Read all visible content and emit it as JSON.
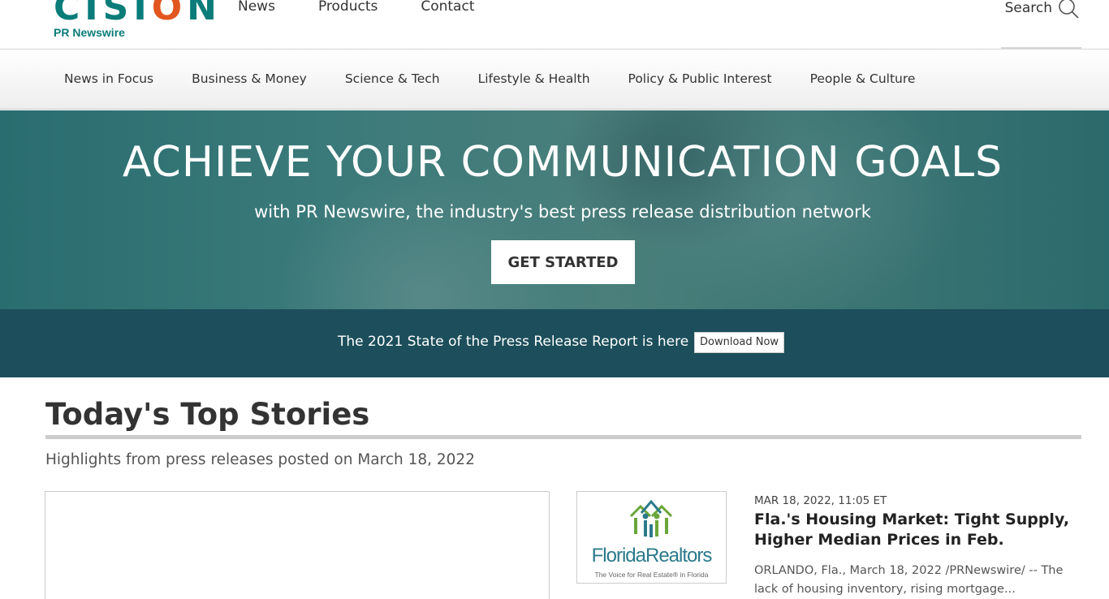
{
  "header": {
    "logo_word": "CISION",
    "logo_sub": "PR Newswire",
    "nav": [
      "News",
      "Products",
      "Contact"
    ],
    "search_label": "Search"
  },
  "categories": [
    "News in Focus",
    "Business & Money",
    "Science & Tech",
    "Lifestyle & Health",
    "Policy & Public Interest",
    "People & Culture"
  ],
  "hero": {
    "title": "ACHIEVE YOUR COMMUNICATION GOALS",
    "subtitle": "with PR Newswire, the industry's best press release distribution network",
    "cta_label": "GET STARTED"
  },
  "banner": {
    "text": "The 2021 State of the Press Release Report is here",
    "button_label": "Download Now"
  },
  "top_stories": {
    "title": "Today's Top Stories",
    "subtitle": "Highlights from press releases posted on March 18, 2022",
    "items": [
      {
        "logo_name": "FloridaRealtors",
        "logo_tagline": "The Voice for Real Estate® in Florida",
        "date": "MAR 18, 2022, 11:05 ET",
        "title": "Fla.'s Housing Market: Tight Supply, Higher Median Prices in Feb.",
        "summary": "ORLANDO, Fla., March 18, 2022 /PRNewswire/ -- The lack of housing inventory, rising mortgage..."
      }
    ]
  },
  "colors": {
    "brand_teal": "#0a7c7a",
    "brand_orange": "#e2561f",
    "banner_bg": "#1c4f5b"
  }
}
